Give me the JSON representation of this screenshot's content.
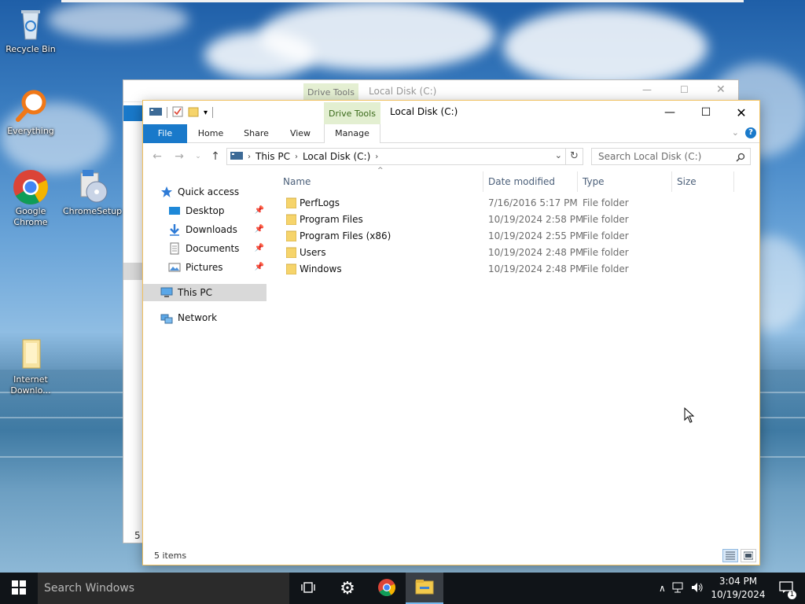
{
  "desktop": {
    "icons": [
      {
        "label": "Recycle Bin"
      },
      {
        "label": "Everything"
      },
      {
        "label": "Google Chrome"
      },
      {
        "label": "ChromeSetup"
      },
      {
        "label": "Internet Downlo..."
      }
    ]
  },
  "back_window": {
    "drive_tools": "Drive Tools",
    "title": "Local Disk (C:)",
    "partial_status": "5"
  },
  "window": {
    "title": "Local Disk (C:)",
    "drive_tools": "Drive Tools",
    "ribbon_tabs": [
      "File",
      "Home",
      "Share",
      "View",
      "Manage"
    ],
    "help": "?",
    "address": {
      "segments": [
        "This PC",
        "Local Disk (C:)"
      ]
    },
    "search_placeholder": "Search Local Disk (C:)",
    "nav": {
      "quick_access": "Quick access",
      "pinned": [
        "Desktop",
        "Downloads",
        "Documents",
        "Pictures"
      ],
      "this_pc": "This PC",
      "network": "Network"
    },
    "columns": [
      "Name",
      "Date modified",
      "Type",
      "Size"
    ],
    "files": [
      {
        "name": "PerfLogs",
        "date": "7/16/2016 5:17 PM",
        "type": "File folder"
      },
      {
        "name": "Program Files",
        "date": "10/19/2024 2:58 PM",
        "type": "File folder"
      },
      {
        "name": "Program Files (x86)",
        "date": "10/19/2024 2:55 PM",
        "type": "File folder"
      },
      {
        "name": "Users",
        "date": "10/19/2024 2:48 PM",
        "type": "File folder"
      },
      {
        "name": "Windows",
        "date": "10/19/2024 2:48 PM",
        "type": "File folder"
      }
    ],
    "status": "5 items"
  },
  "taskbar": {
    "search_text": "Search Windows",
    "time": "3:04 PM",
    "date": "10/19/2024",
    "notification_count": "1"
  },
  "colors": {
    "accent": "#1979ca",
    "drive_tools_bg": "#e3efd1",
    "taskbar": "#101418"
  }
}
